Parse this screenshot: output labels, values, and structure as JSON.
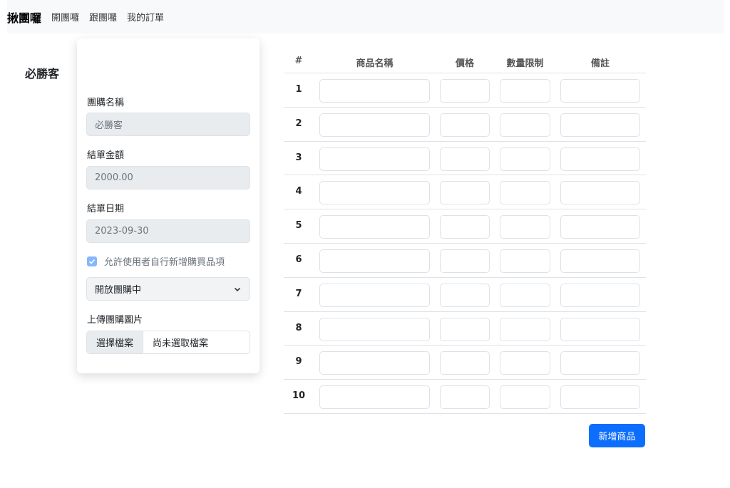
{
  "navbar": {
    "brand": "揪團囉",
    "links": [
      "開團囉",
      "跟團囉",
      "我的訂單"
    ]
  },
  "form": {
    "title": "必勝客",
    "fields": [
      {
        "label": "團購名稱",
        "value": "必勝客"
      },
      {
        "label": "結單金額",
        "value": "2000.00"
      },
      {
        "label": "結單日期",
        "value": "2023-09-30"
      }
    ],
    "allow_user_add_label": "允許使用者自行新增購買品項",
    "allow_user_add_checked": true,
    "status_select": "開放團購中",
    "upload_label": "上傳團購圖片",
    "file_button": "選擇檔案",
    "file_status": "尚未選取檔案"
  },
  "table": {
    "headers": [
      "#",
      "商品名稱",
      "價格",
      "數量限制",
      "備註"
    ],
    "rows": [
      "1",
      "2",
      "3",
      "4",
      "5",
      "6",
      "7",
      "8",
      "9",
      "10"
    ]
  },
  "add_button": "新增商品",
  "colors": {
    "primary": "#0d6efd",
    "checkbox": "#86b7fe",
    "navbar_bg": "#f8f9fa"
  }
}
